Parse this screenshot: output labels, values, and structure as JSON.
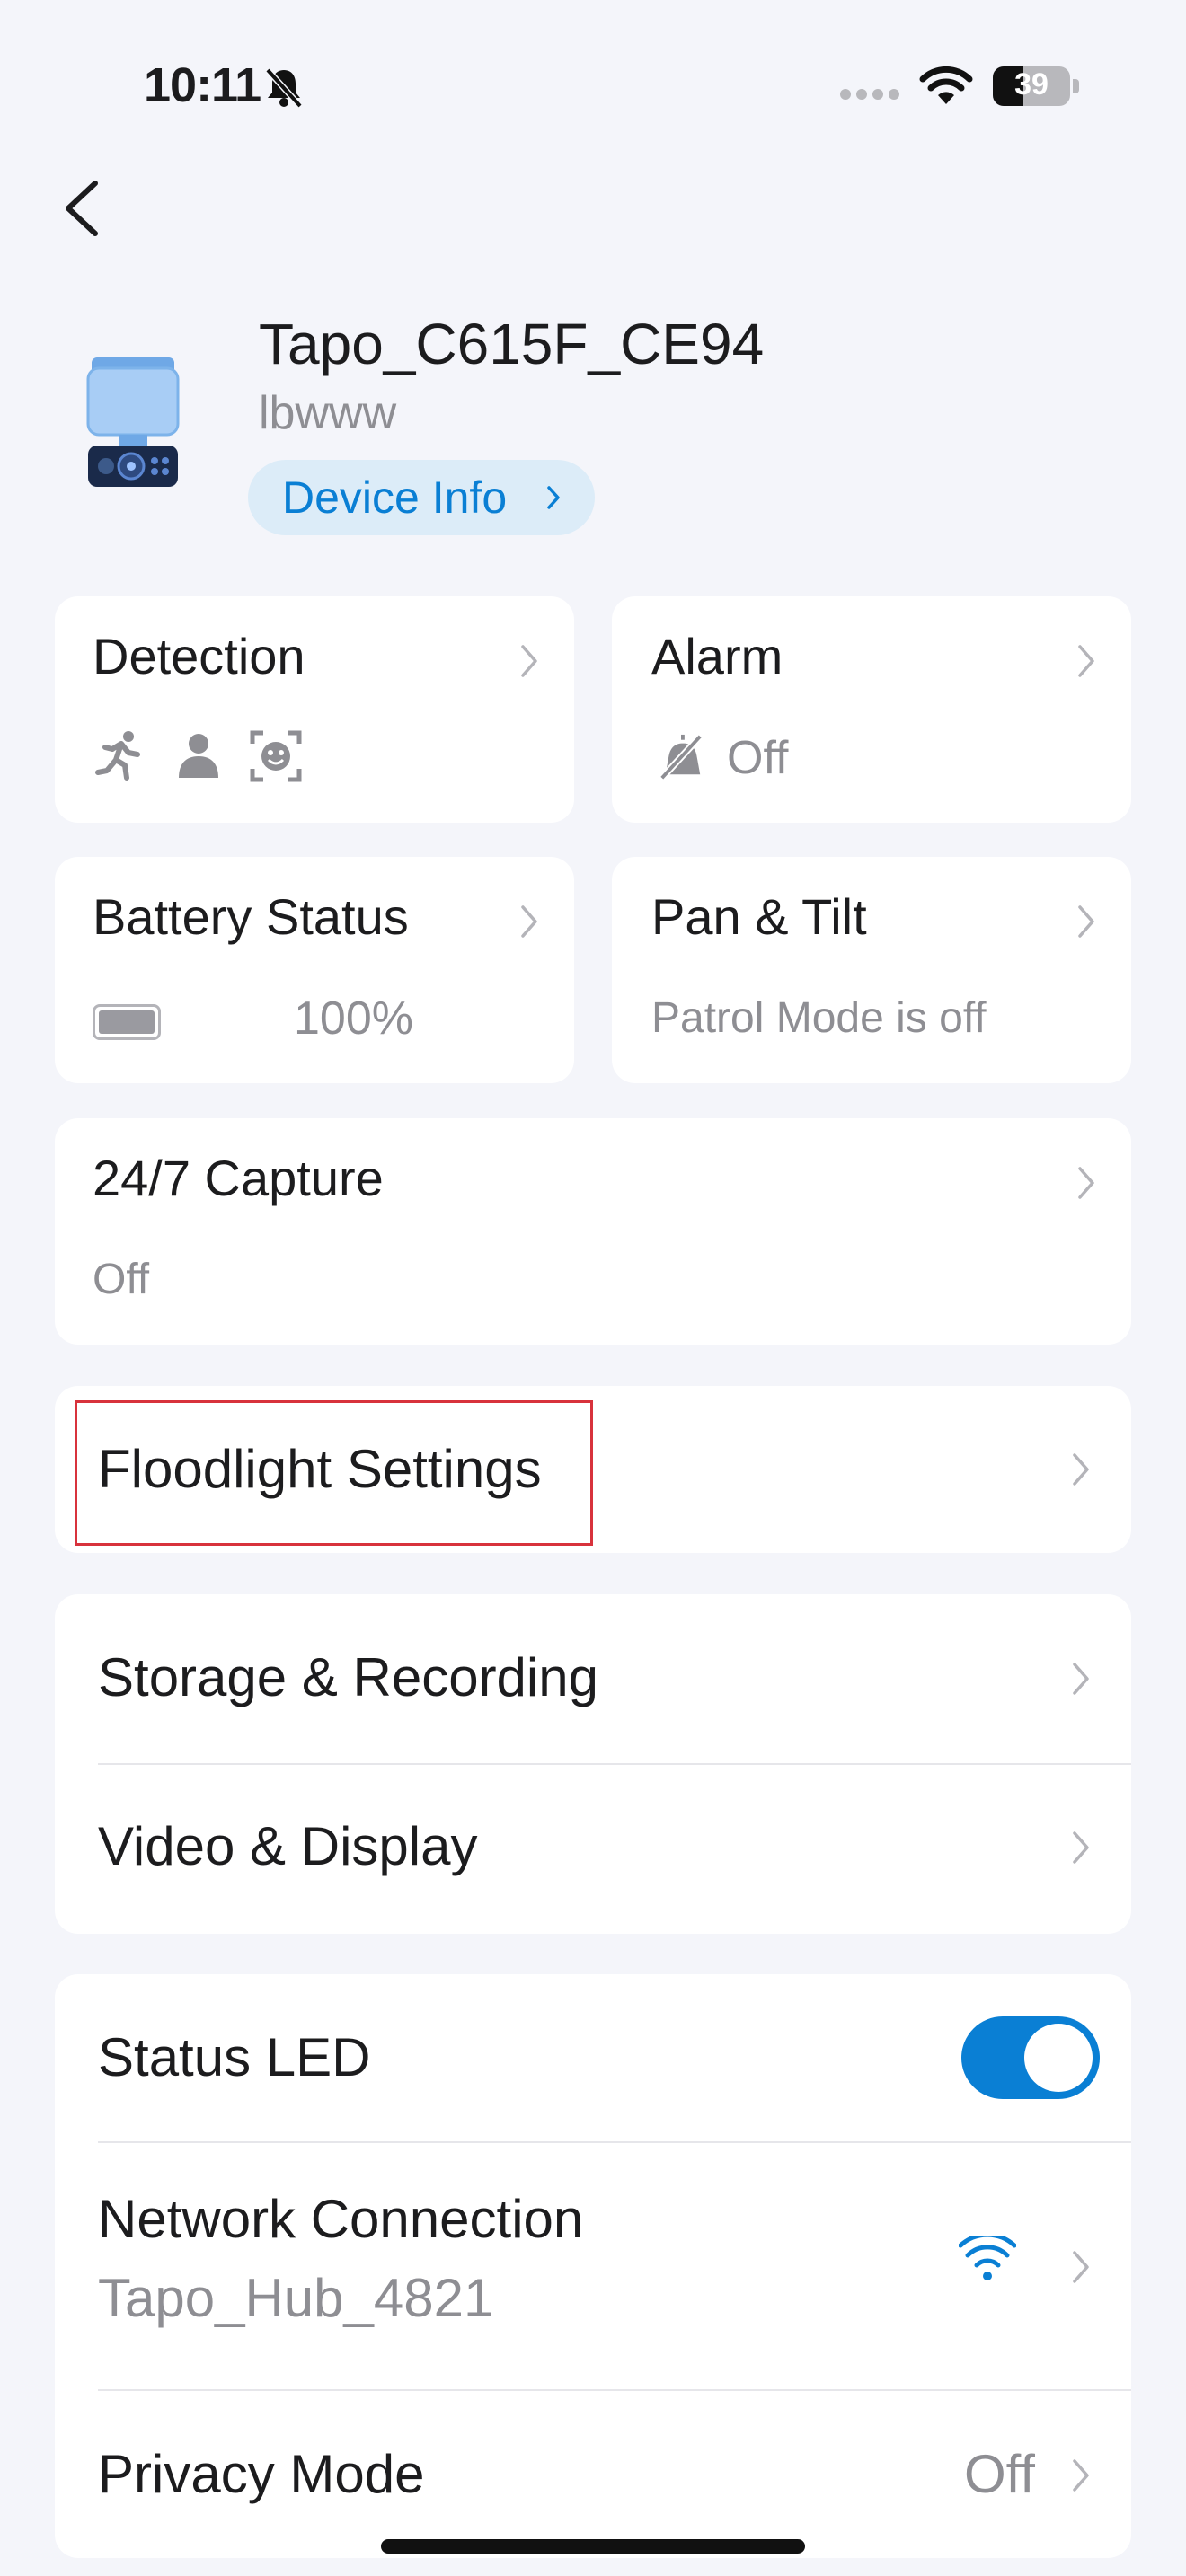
{
  "status_bar": {
    "time": "10:11",
    "battery_level": "39",
    "battery_fraction": 0.39
  },
  "device": {
    "name": "Tapo_C615F_CE94",
    "location": "lbwww",
    "info_label": "Device Info"
  },
  "cards": {
    "detection": {
      "title": "Detection"
    },
    "alarm": {
      "title": "Alarm",
      "value": "Off"
    },
    "battery": {
      "title": "Battery Status",
      "value": "100%",
      "fraction": 1.0
    },
    "pan_tilt": {
      "title": "Pan & Tilt",
      "value": "Patrol Mode is off"
    },
    "capture": {
      "title": "24/7 Capture",
      "value": "Off"
    }
  },
  "rows": {
    "floodlight": "Floodlight Settings",
    "storage": "Storage & Recording",
    "video": "Video & Display",
    "status_led": "Status LED",
    "status_led_on": true,
    "network": "Network Connection",
    "network_name": "Tapo_Hub_4821",
    "privacy": "Privacy Mode",
    "privacy_value": "Off"
  },
  "colors": {
    "accent": "#0a7fd4",
    "highlight": "#d8323c",
    "background": "#f4f5fa"
  }
}
